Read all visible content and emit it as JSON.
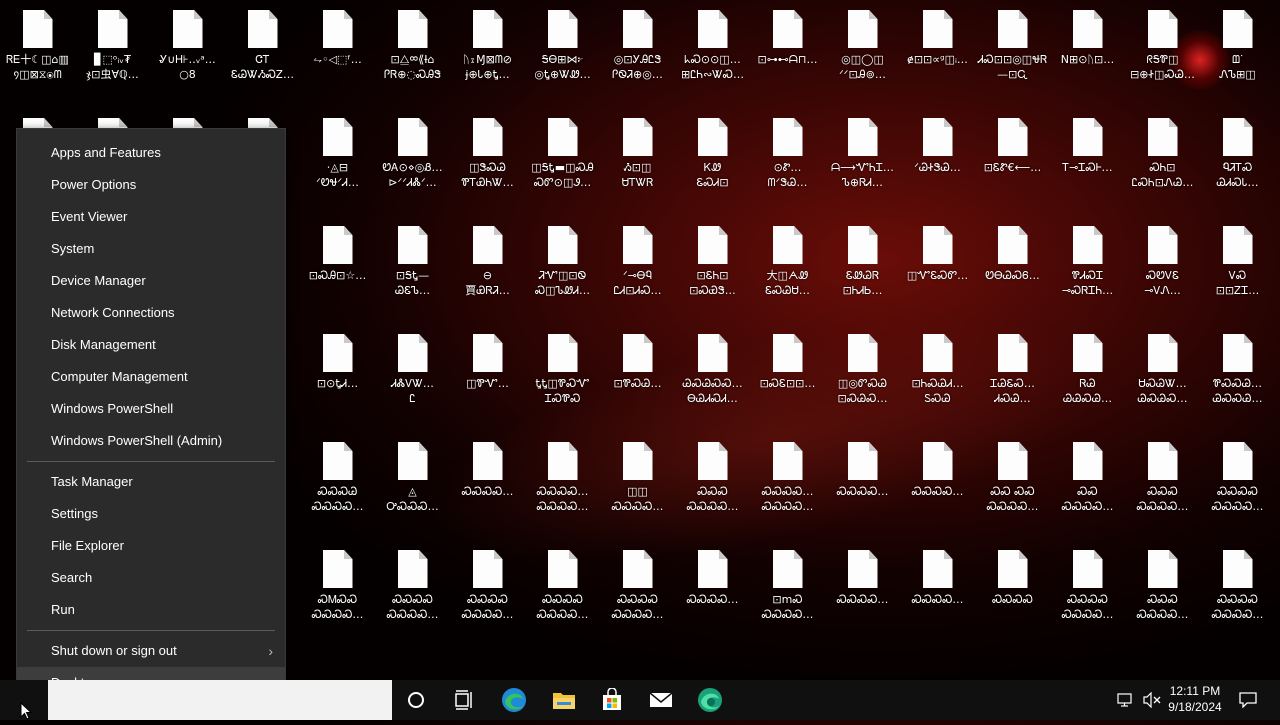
{
  "desktop": {
    "files": [
      "ᏒᎬ⼗☾◫⌂▥\n᠀◫⊠⧖⦿ᗰ",
      "▊⬚ᵒᵢᵥ₮\nჯ⊡虫∀ℚ…",
      "Ꮍ∪Ꮋ⊦‥ᵥᵃ…\n○8",
      "ᏣᎢ\nᏋᏊᏔᏱᏍᏃ…",
      "⥊◦◁⬚ᶠ…",
      "⊡⧋ᢁ⟪Ɨ⌂\nᎵᏒ⊕◌ᏍᎯᏕ",
      "ᚢ⧖Ɱ⊠ᗰ⊘\nɉ⊕Ꮣ⊕Ꮏ…",
      "ᎦᎾ⊞⋈፦\n◎Ꮏ⊕ᏔᏪ…",
      "◎⊡ᎩᎯᏝᏕ\nᎵᏫᏘ⊕◎…",
      "ᖾᏍ⊙⊙◫…\n⊞ᏝᏂ∾ᏔᏍ…",
      "⊡⊶⊷ᗩ⊓…",
      "◎◫◯◫\nᐟᐟ⊡Ꭿ⊚…",
      "ɇ⊡⊡∝ᵍ◫ᵢ…",
      "ᏗᏍ⊡⊡◎◫ᏠᏒ\n—⊡Ꮹ",
      "N⊞⊙ᚢ⊡…",
      "ᖇᎦᏈ◫\n⊟⊕Ꮠ◫ᏍᏊ…",
      "ᗶᐝ\nᏁᏖ⊞◫",
      "ᗅ",
      "",
      "",
      "",
      "⋅◬⊟\nᐟᏬᏠᐟᏗ…",
      "ᏬᎪ⊙⋄◎Ᏸ…\n⊳ᐟᐟᏗᏜᐟ…",
      "◫ᏕᏍᏊ\nᏈᎢᏯᏂᏔ…",
      "◫ᎦᎿ▬◫ᏍᎯ\nᏍᏛ⊙◫Ꮽ…",
      "Ᏹ⊡◫\nᏌᎢᏔᏒ",
      "ᏦᏪ\nᏋᏍᏗ⊡",
      "⊙Ꮡ…\nᗰᐟᏕᏊ…",
      "ᗩ⟶ᏉᏂᏆ…\nᏖ⊕ᏒᏗ…",
      "ᐟᏊᏐᏕᏊ…",
      "⊡ᏋᏑ€⟵…",
      "Ꭲ⊸ᏆᏍᎰ…",
      "ᏍᏂ⊡\nᏝᏍᏂ⊡ᏁᏊ…",
      "ᏄᏘᎢᏍ\nᏊᏗᏍᏓ…",
      "◫",
      "",
      "",
      "",
      "⊡ᏍᎯ⊡☆…",
      "⊡ᎦᎿ—\nᏊᏋᏖ…",
      "⊖\n賈ᏯᏒᏘ…",
      "ᏘᏉ◫⊡Ꮻ\nᏍ◫ᏖᏪᏗ…",
      "ᐟ⊸ᎾᏄ\nᏝᏗ⊡ᏗᏍ…",
      "⊡ᏋᏂ⊡\n⊡ᏍᏯᏕ…",
      "大◫ᗅᏪ\nᏋᏍᏊᏌ…",
      "ᏋᏪᏊᏒ\n⊡ᏂᏗᏏ…",
      "◫ᏉᏋᏍᏛ…",
      "ᏬᎾᏊᏍᏮ…",
      "ᏈᏗᏍᏆ\n⊸ᏍᏒᏆᏂ…",
      "ᏍᏬᏙᏋ\n⊸ᏙᏁ…",
      "ᏙᏍ\n⊡⊡ᏃᏆ…",
      "ᐟ",
      "",
      "",
      "",
      "⊡⊙ᎿᏗ…",
      "ᏗᏜᏙᏔ…\nᏝ",
      "◫ᏈᏉ…",
      "ᎿᎿ◫ᏈᏍᏉ\nᏆᏍᏈᏍ",
      "⊡ᏈᏍᏊ…",
      "ᏊᏍᏊᏍᏍ…\nᎾᏊᏗᏍᏗ…",
      "⊡ᏍᏋ⊡⊡…",
      "◫◎ᏛᏍᏊ\n⊡ᏍᏊᏍ…",
      "⊡ᏂᏍᏊᏗ…\nᏚᏍᏊ",
      "ᏆᏊᏋᏍ…\nᏗᏍᏊ…",
      "ᏒᏊ\nᏊᏊᏍᏊ…",
      "ᏌᏍᏊᏔ…\nᏊᏍᏊᏍ…",
      "ᏈᏍᏍᏊ…\nᏊᏍᏍᏊ…",
      "Ꮛ",
      "",
      "",
      "",
      "ᏍᏍᏍᏊ\nᏍᏍᏍᏍ…",
      "◬\nᎤᏍᏍᏍ…",
      "ᏍᏍᏍᏍ…",
      "ᏍᏍᏍᏍ…\nᏍᏍᏍᏍ…",
      "◫◫\nᏍᏍᏍᏍ…",
      "ᏍᏍᏍ\nᏍᏍᏍᏍ…",
      "ᏍᏍᏍᏍ…\nᏍᏍᏍᏍ…",
      "ᏍᏍᏍᏍ…",
      "ᏍᏍᏍᏍ…",
      "ᏍᏍ ᏍᏍ\nᏍᏍᏍᏍ…",
      "ᏍᏍ\nᏍᏍᏍᏍ…",
      "ᏍᏍᏍ\nᏍᏍᏍᏍ…",
      "ᏍᏍᏍᏍ\nᏍᏍᏍᏍ…",
      "ᐟᏍ",
      "",
      "",
      "",
      "ᏍᎷᏍᏍ\nᏍᏍᏍᏍ…",
      "ᏍᏍᏍᏍ\nᏍᏍᏍᏍ…",
      "ᏍᏍᏍᏍ\nᏍᏍᏍᏍ…",
      "ᏍᏍᏍᏍ\nᏍᏍᏍᏍ…",
      "ᏍᏍᏍᏍ\nᏍᏍᏍᏍ…",
      "ᏍᏍᏍᏍ…",
      "⊡mᏍ\nᏍᏍᏍᏍ…",
      "ᏍᏍᏍᏍ…",
      "ᏍᏍᏍᏍ…",
      "ᏍᏍᏍᏍ",
      "ᏍᏍᏍᏍ\nᏍᏍᏍᏍ…",
      "ᏍᏍᏍ\nᏍᏍᏍᏍ…",
      "ᏍᏍᏍᏍ\nᏍᏍᏍᏍ…"
    ]
  },
  "menu": {
    "groups": [
      [
        "Apps and Features",
        "Power Options",
        "Event Viewer",
        "System",
        "Device Manager",
        "Network Connections",
        "Disk Management",
        "Computer Management",
        "Windows PowerShell",
        "Windows PowerShell (Admin)"
      ],
      [
        "Task Manager",
        "Settings",
        "File Explorer",
        "Search",
        "Run"
      ],
      [
        "Shut down or sign out",
        "Desktop"
      ]
    ],
    "highlighted": "Desktop",
    "submenu_item": "Shut down or sign out"
  },
  "taskbar": {
    "icons": [
      "cortana-icon",
      "task-view-icon",
      "edge-icon",
      "file-explorer-icon",
      "store-icon",
      "mail-icon",
      "edge-dev-icon"
    ],
    "tray": [
      "network-icon",
      "volume-muted-icon"
    ],
    "time": "12:11 PM",
    "date": "9/18/2024",
    "colors": {
      "taskbar": "#101010",
      "menu": "#2b2b2b",
      "menu_highlight": "#3d3d3d"
    }
  }
}
